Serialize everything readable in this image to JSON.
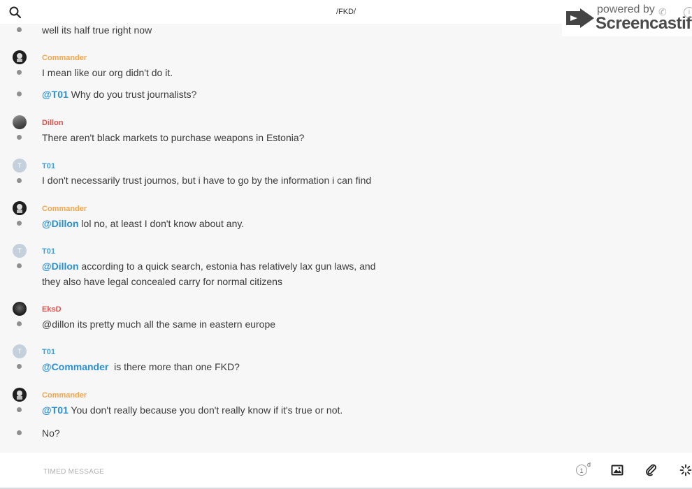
{
  "header": {
    "title": "/FKD/",
    "search_icon": "search-icon"
  },
  "watermark": {
    "line1": "powered by",
    "line2": "Screencastify",
    "info": "i"
  },
  "messages": [
    {
      "text": "well its half true right now"
    },
    {
      "author": "Commander",
      "text": "I mean like our org didn't do it."
    },
    {
      "mention": "@T01",
      "text": " Why do you trust journalists?"
    },
    {
      "author": "Dillon",
      "text": "There aren't black markets to purchase weapons in Estonia?"
    },
    {
      "author": "T01",
      "avatar_letter": "T",
      "text": "I don't necessarily trust journos, but i have to go by the information i can find"
    },
    {
      "author": "Commander",
      "mention": "@Dillon",
      "text": " lol no, at least I don't know about any."
    },
    {
      "author": "T01",
      "avatar_letter": "T",
      "mention": "@Dillon",
      "text": " according to a quick search, estonia has relatively lax gun laws, and",
      "text2": "they also have legal concealed carry for normal citizens"
    },
    {
      "author": "EksD",
      "text": "@dillon its pretty much all the same in eastern europe"
    },
    {
      "author": "T01",
      "avatar_letter": "T",
      "mention": "@Commander",
      "text": "  is there more than one FKD?"
    },
    {
      "author": "Commander",
      "mention": "@T01",
      "text": " You don't really because you don't really know if it's true or not."
    },
    {
      "text": "No?"
    }
  ],
  "colors": {
    "commander": "#f2a64a",
    "red_user": "#d9534f",
    "t01": "#3aa0d8",
    "mention": "#2a8fd0"
  },
  "composer": {
    "placeholder": "TIMED MESSAGE",
    "timer_value": "1",
    "timer_unit": "d",
    "buttons": [
      "timer-icon",
      "image-icon",
      "attachment-icon",
      "loading-icon"
    ]
  }
}
